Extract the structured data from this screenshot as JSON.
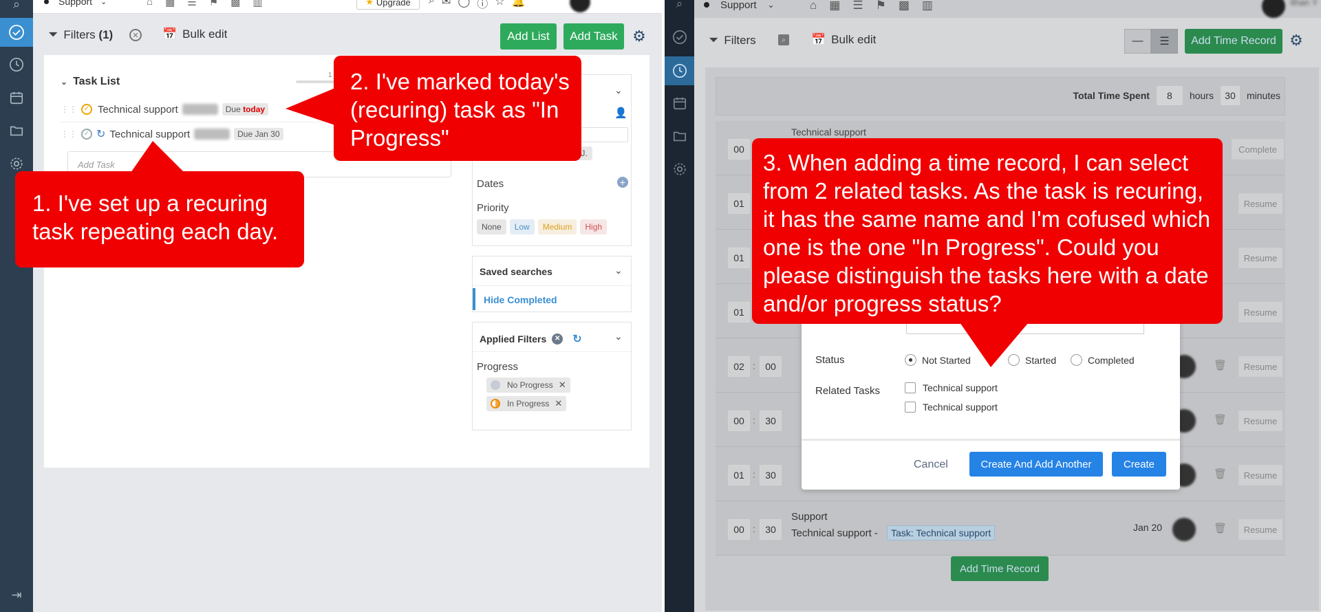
{
  "left": {
    "top": {
      "workspace": "Support",
      "upgrade": "Upgrade"
    },
    "toolbar": {
      "filters": "Filters",
      "filters_count": "(1)",
      "bulk_edit": "Bulk edit",
      "add_list": "Add List",
      "add_task": "Add Task"
    },
    "tasklist": {
      "title": "Task List",
      "progress_num": "1",
      "task1": {
        "name": "Technical support",
        "due_prefix": "Due",
        "due_value": "today"
      },
      "task2": {
        "name": "Technical support",
        "due": "Due Jan 30"
      },
      "add_task_placeholder": "Add Task"
    },
    "filters": {
      "assignee_chip": "J.",
      "dates": "Dates",
      "priority": "Priority",
      "priority_options": [
        "None",
        "Low",
        "Medium",
        "High"
      ],
      "saved_searches": "Saved searches",
      "hide_completed": "Hide Completed",
      "applied_filters": "Applied Filters",
      "progress": "Progress",
      "progress_chips": [
        "No Progress",
        "In Progress"
      ]
    }
  },
  "right": {
    "top": {
      "workspace": "Support",
      "user": "Ilhan Y"
    },
    "toolbar": {
      "filters": "Filters",
      "bulk_edit": "Bulk edit",
      "add_time_record": "Add Time Record"
    },
    "total": {
      "label": "Total Time Spent",
      "hours": "8",
      "hours_label": "hours",
      "minutes": "30",
      "minutes_label": "minutes"
    },
    "records": [
      {
        "h": "00",
        "m": "",
        "title": "Technical support",
        "action": "Complete"
      },
      {
        "h": "01",
        "m": "",
        "action": "Resume"
      },
      {
        "h": "01",
        "m": "",
        "action": "Resume"
      },
      {
        "h": "01",
        "m": "",
        "action": "Resume"
      },
      {
        "h": "02",
        "m": "00",
        "action": "Resume"
      },
      {
        "h": "00",
        "m": "30",
        "action": "Resume"
      },
      {
        "h": "01",
        "m": "30",
        "action": "Resume"
      },
      {
        "h": "00",
        "m": "30",
        "title": "Support",
        "subtitle": "Technical support -",
        "task_tag": "Task: Technical support",
        "date": "Jan 20",
        "action": "Resume"
      }
    ],
    "add_time_record_bottom": "Add Time Record",
    "modal": {
      "status_label": "Status",
      "status_options": [
        "Not Started",
        "Started",
        "Completed"
      ],
      "related_label": "Related Tasks",
      "related_tasks": [
        "Technical support",
        "Technical support"
      ],
      "cancel": "Cancel",
      "create_another": "Create And Add Another",
      "create": "Create"
    }
  },
  "callouts": {
    "c1": "1. I've set up a recuring task repeating each day.",
    "c2": "2. I've marked today's (recuring) task as \"In Progress\"",
    "c3": "3. When adding a time record, I can select from 2 related tasks. As the task is recuring, it has the same name and I'm cofused which one is the one \"In Progress\". Could you please distinguish the tasks here with a date and/or progress status?"
  },
  "colors": {
    "green": "#2eaa5c",
    "red_callout": "#f00000",
    "sidebar": "#2c3e50",
    "blue": "#1a73e8"
  }
}
